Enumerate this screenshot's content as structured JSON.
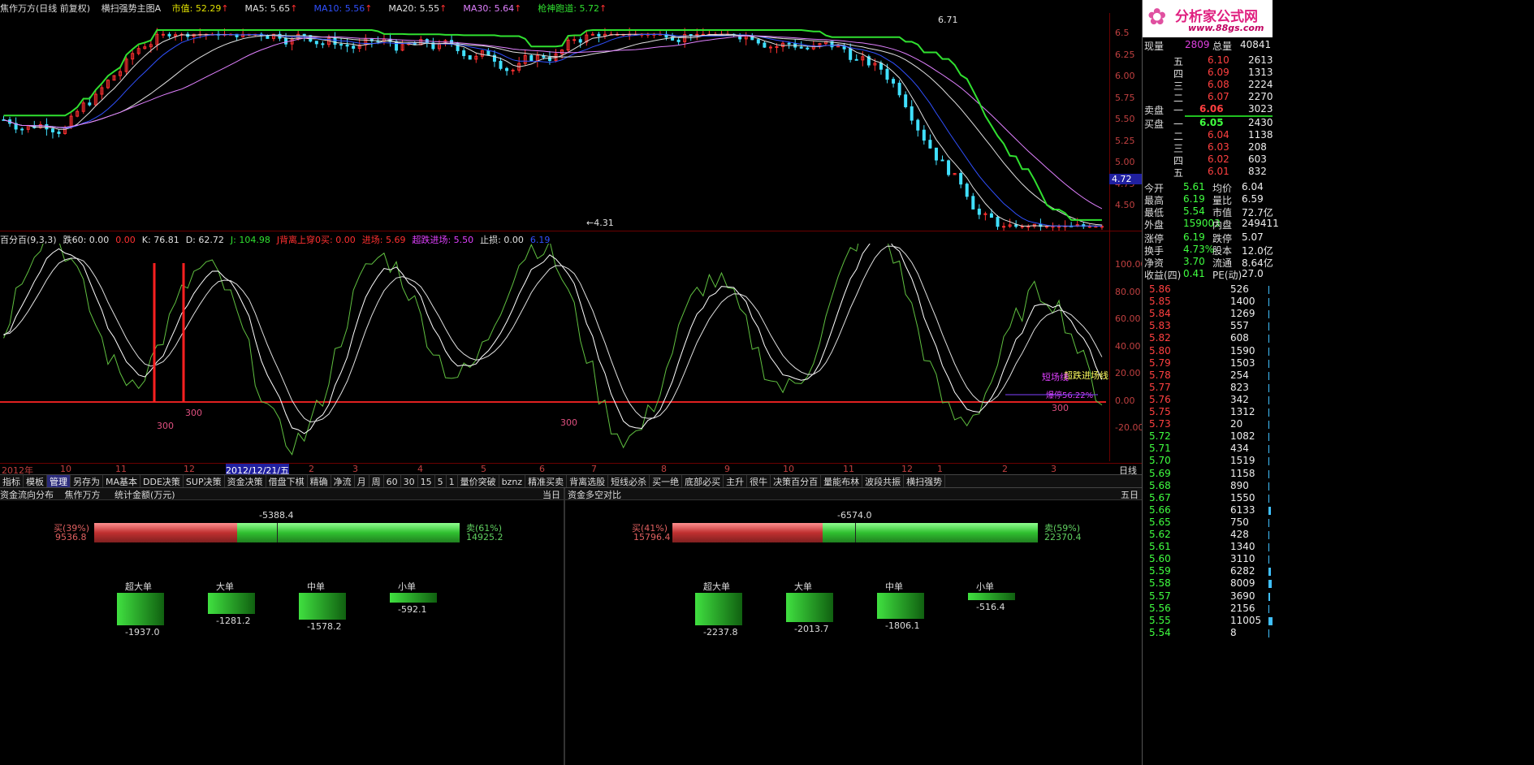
{
  "header": {
    "title": "焦作万方(日线 前复权)",
    "template": "横扫强势主图A",
    "items": [
      {
        "label": "市值: 52.29",
        "color": "#e0e000"
      },
      {
        "label": "MA5: 5.65",
        "color": "#e0e0e0"
      },
      {
        "label": "MA10: 5.56",
        "color": "#3050ff"
      },
      {
        "label": "MA20: 5.55",
        "color": "#e0e0e0"
      },
      {
        "label": "MA30: 5.64",
        "color": "#e080ff"
      },
      {
        "label": "枪神跑道: 5.72",
        "color": "#30e030"
      }
    ]
  },
  "price_axis": {
    "ticks": [
      "6.5",
      "6.25",
      "6.00",
      "5.75",
      "5.50",
      "5.25",
      "5.00",
      "4.75",
      "4.50"
    ],
    "current": "4.72",
    "high_label": "6.71",
    "low_label": "4.31"
  },
  "indicator": {
    "labels": [
      {
        "text": "百分百(9,3,3)",
        "color": "#e0e0e0"
      },
      {
        "text": "跌60: 0.00",
        "color": "#e0e0e0"
      },
      {
        "text": "0.00",
        "color": "#ff3030"
      },
      {
        "text": "K: 76.81",
        "color": "#e0e0e0"
      },
      {
        "text": "D: 62.72",
        "color": "#e0e0e0"
      },
      {
        "text": "J: 104.98",
        "color": "#30e030"
      },
      {
        "text": "J背离上穿0买: 0.00",
        "color": "#ff3030"
      },
      {
        "text": "进场: 5.69",
        "color": "#ff3030"
      },
      {
        "text": "超跌进场: 5.50",
        "color": "#e040ff"
      },
      {
        "text": "止损: 0.00",
        "color": "#e0e0e0"
      },
      {
        "text": "6.19",
        "color": "#3050ff"
      }
    ],
    "ticks": [
      "100.00",
      "80.00",
      "60.00",
      "40.00",
      "20.00",
      "0.00",
      "-20.00"
    ],
    "markers": [
      "300",
      "300",
      "300",
      "300"
    ],
    "notes": {
      "a": "超跌进场线",
      "b": "短场线",
      "c": "爆停56.22%"
    }
  },
  "time_axis": {
    "labels": [
      "2012年",
      "10",
      "11",
      "12",
      "2012/12/21/五",
      "2",
      "3",
      "4",
      "5",
      "6",
      "7",
      "8",
      "9",
      "10",
      "11",
      "12",
      "1",
      "2",
      "3"
    ],
    "period": "日线"
  },
  "toolbar": [
    "指标",
    "模板",
    "管理",
    "另存为",
    "MA基本",
    "DDE决策",
    "SUP决策",
    "资金决策",
    "借盘下棋",
    "精确",
    "净流",
    "月",
    "周",
    "60",
    "30",
    "15",
    "5",
    "1",
    "量价突破",
    "bznz",
    "精准买卖",
    "背离选股",
    "短线必杀",
    "买一绝",
    "底部必买",
    "主升",
    "很牛",
    "决策百分百",
    "量能布林",
    "波段共振",
    "横扫强势"
  ],
  "fund_panel": {
    "left": {
      "tab1": "资金流向分布",
      "tab2": "焦作万方",
      "tab3": "统计金额(万元)",
      "right_tab": "当日",
      "net": "-5388.4",
      "buy_pct": "买(39%)",
      "buy_val": "9536.8",
      "sell_pct": "卖(61%)",
      "sell_val": "14925.2",
      "buy_ratio": 0.39,
      "cats": [
        {
          "name": "超大单",
          "val": "-1937.0"
        },
        {
          "name": "大单",
          "val": "-1281.2"
        },
        {
          "name": "中单",
          "val": "-1578.2"
        },
        {
          "name": "小单",
          "val": "-592.1"
        }
      ]
    },
    "right": {
      "tab": "资金多空对比",
      "right_tab": "五日",
      "net": "-6574.0",
      "buy_pct": "买(41%)",
      "buy_val": "15796.4",
      "sell_pct": "卖(59%)",
      "sell_val": "22370.4",
      "buy_ratio": 0.41,
      "cats": [
        {
          "name": "超大单",
          "val": "-2237.8"
        },
        {
          "name": "大单",
          "val": "-2013.7"
        },
        {
          "name": "中单",
          "val": "-1806.1"
        },
        {
          "name": "小单",
          "val": "-516.4"
        }
      ]
    }
  },
  "quote": {
    "logo": "分析家公式网",
    "logo_url": "www.88gs.com",
    "xianliang_label": "现量",
    "xianliang": "2809",
    "zongliang_label": "总量",
    "zongliang": "40841",
    "asks": [
      {
        "l": "五",
        "p": "6.10",
        "v": "2613"
      },
      {
        "l": "四",
        "p": "6.09",
        "v": "1313"
      },
      {
        "l": "三",
        "p": "6.08",
        "v": "2224"
      },
      {
        "l": "二",
        "p": "6.07",
        "v": "2270"
      }
    ],
    "ask1_label": "卖盘",
    "ask1_l": "一",
    "ask1_p": "6.06",
    "ask1_v": "3023",
    "bid1_label": "买盘",
    "bid1_l": "一",
    "bid1_p": "6.05",
    "bid1_v": "2430",
    "bids": [
      {
        "l": "二",
        "p": "6.04",
        "v": "1138"
      },
      {
        "l": "三",
        "p": "6.03",
        "v": "208"
      },
      {
        "l": "四",
        "p": "6.02",
        "v": "603"
      },
      {
        "l": "五",
        "p": "6.01",
        "v": "832"
      }
    ],
    "stats": [
      [
        "今开",
        "5.61",
        "均价",
        "6.04"
      ],
      [
        "最高",
        "6.19",
        "量比",
        "6.59"
      ],
      [
        "最低",
        "5.54",
        "市值",
        "72.7亿"
      ],
      [
        "外盘",
        "159003",
        "内盘",
        "249411"
      ],
      [
        "涨停",
        "6.19",
        "跌停",
        "5.07"
      ],
      [
        "换手",
        "4.73%",
        "股本",
        "12.0亿"
      ],
      [
        "净资",
        "3.70",
        "流通",
        "8.64亿"
      ],
      [
        "收益(四)",
        "0.41",
        "PE(动)",
        "27.0"
      ]
    ],
    "vol_profile": [
      [
        "5.86",
        "526"
      ],
      [
        "5.85",
        "1400"
      ],
      [
        "5.84",
        "1269"
      ],
      [
        "5.83",
        "557"
      ],
      [
        "5.82",
        "608"
      ],
      [
        "5.80",
        "1590"
      ],
      [
        "5.79",
        "1503"
      ],
      [
        "5.78",
        "254"
      ],
      [
        "5.77",
        "823"
      ],
      [
        "5.76",
        "342"
      ],
      [
        "5.75",
        "1312"
      ],
      [
        "5.73",
        "20"
      ],
      [
        "5.72",
        "1082"
      ],
      [
        "5.71",
        "434"
      ],
      [
        "5.70",
        "1519"
      ],
      [
        "5.69",
        "1158"
      ],
      [
        "5.68",
        "890"
      ],
      [
        "5.67",
        "1550"
      ],
      [
        "5.66",
        "6133"
      ],
      [
        "5.65",
        "750"
      ],
      [
        "5.62",
        "428"
      ],
      [
        "5.61",
        "1340"
      ],
      [
        "5.60",
        "3110"
      ],
      [
        "5.59",
        "6282"
      ],
      [
        "5.58",
        "8009"
      ],
      [
        "5.57",
        "3690"
      ],
      [
        "5.56",
        "2156"
      ],
      [
        "5.55",
        "11005"
      ],
      [
        "5.54",
        "8"
      ]
    ]
  }
}
